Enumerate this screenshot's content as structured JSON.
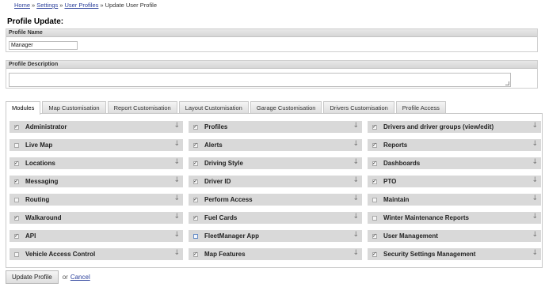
{
  "breadcrumb": {
    "items": [
      "Home",
      "Settings",
      "User Profiles"
    ],
    "current": "Update User Profile",
    "separator": "»"
  },
  "page_title": "Profile Update:",
  "profile_name": {
    "label": "Profile Name",
    "value": "Manager"
  },
  "profile_description": {
    "label": "Profile Description",
    "value": ""
  },
  "tabs": [
    {
      "label": "Modules",
      "active": true
    },
    {
      "label": "Map Customisation",
      "active": false
    },
    {
      "label": "Report Customisation",
      "active": false
    },
    {
      "label": "Layout Customisation",
      "active": false
    },
    {
      "label": "Garage Customisation",
      "active": false
    },
    {
      "label": "Drivers Customisation",
      "active": false
    },
    {
      "label": "Profile Access",
      "active": false
    }
  ],
  "modules": [
    {
      "label": "Administrator",
      "checked": true
    },
    {
      "label": "Profiles",
      "checked": true
    },
    {
      "label": "Drivers and driver groups (view/edit)",
      "checked": true
    },
    {
      "label": "Live Map",
      "checked": false
    },
    {
      "label": "Alerts",
      "checked": true
    },
    {
      "label": "Reports",
      "checked": true
    },
    {
      "label": "Locations",
      "checked": true
    },
    {
      "label": "Driving Style",
      "checked": true
    },
    {
      "label": "Dashboards",
      "checked": true
    },
    {
      "label": "Messaging",
      "checked": true
    },
    {
      "label": "Driver ID",
      "checked": true
    },
    {
      "label": "PTO",
      "checked": true
    },
    {
      "label": "Routing",
      "checked": false
    },
    {
      "label": "Perform Access",
      "checked": true
    },
    {
      "label": "Maintain",
      "checked": false
    },
    {
      "label": "Walkaround",
      "checked": true
    },
    {
      "label": "Fuel Cards",
      "checked": true
    },
    {
      "label": "Winter Maintenance Reports",
      "checked": false
    },
    {
      "label": "API",
      "checked": true
    },
    {
      "label": "FleetManager App",
      "checked": false,
      "highlight": true
    },
    {
      "label": "User Management",
      "checked": true
    },
    {
      "label": "Vehicle Access Control",
      "checked": false
    },
    {
      "label": "Map Features",
      "checked": true
    },
    {
      "label": "Security Settings Management",
      "checked": true
    }
  ],
  "module_icon": "arrow-down-icon",
  "footer": {
    "update_label": "Update Profile",
    "or_text": "or",
    "cancel_label": "Cancel"
  }
}
